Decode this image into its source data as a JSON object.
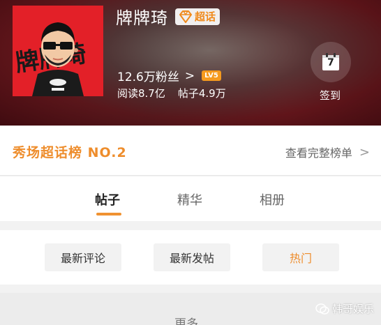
{
  "header": {
    "title": "牌牌琦",
    "super_tag": "超话",
    "cover_text": "牌牌琦",
    "fans": "12.6万粉丝",
    "fans_chevron": ">",
    "level": "LV5",
    "reads": "阅读8.7亿",
    "posts": "帖子4.9万",
    "checkin_day": "7",
    "checkin_label": "签到"
  },
  "ranking": {
    "title": "秀场超话榜 NO.2",
    "link": "查看完整榜单",
    "chevron": ">"
  },
  "tabs": [
    {
      "label": "帖子",
      "active": true
    },
    {
      "label": "精华",
      "active": false
    },
    {
      "label": "相册",
      "active": false
    }
  ],
  "filters": [
    {
      "label": "最新评论"
    },
    {
      "label": "最新发帖"
    },
    {
      "label": "热门",
      "active": true
    }
  ],
  "more": "更多",
  "watermark": "韩哥娱乐",
  "colors": {
    "accent": "#ee8d2c",
    "cover_bg": "#e32028",
    "level_bg": "#f59a1e"
  }
}
